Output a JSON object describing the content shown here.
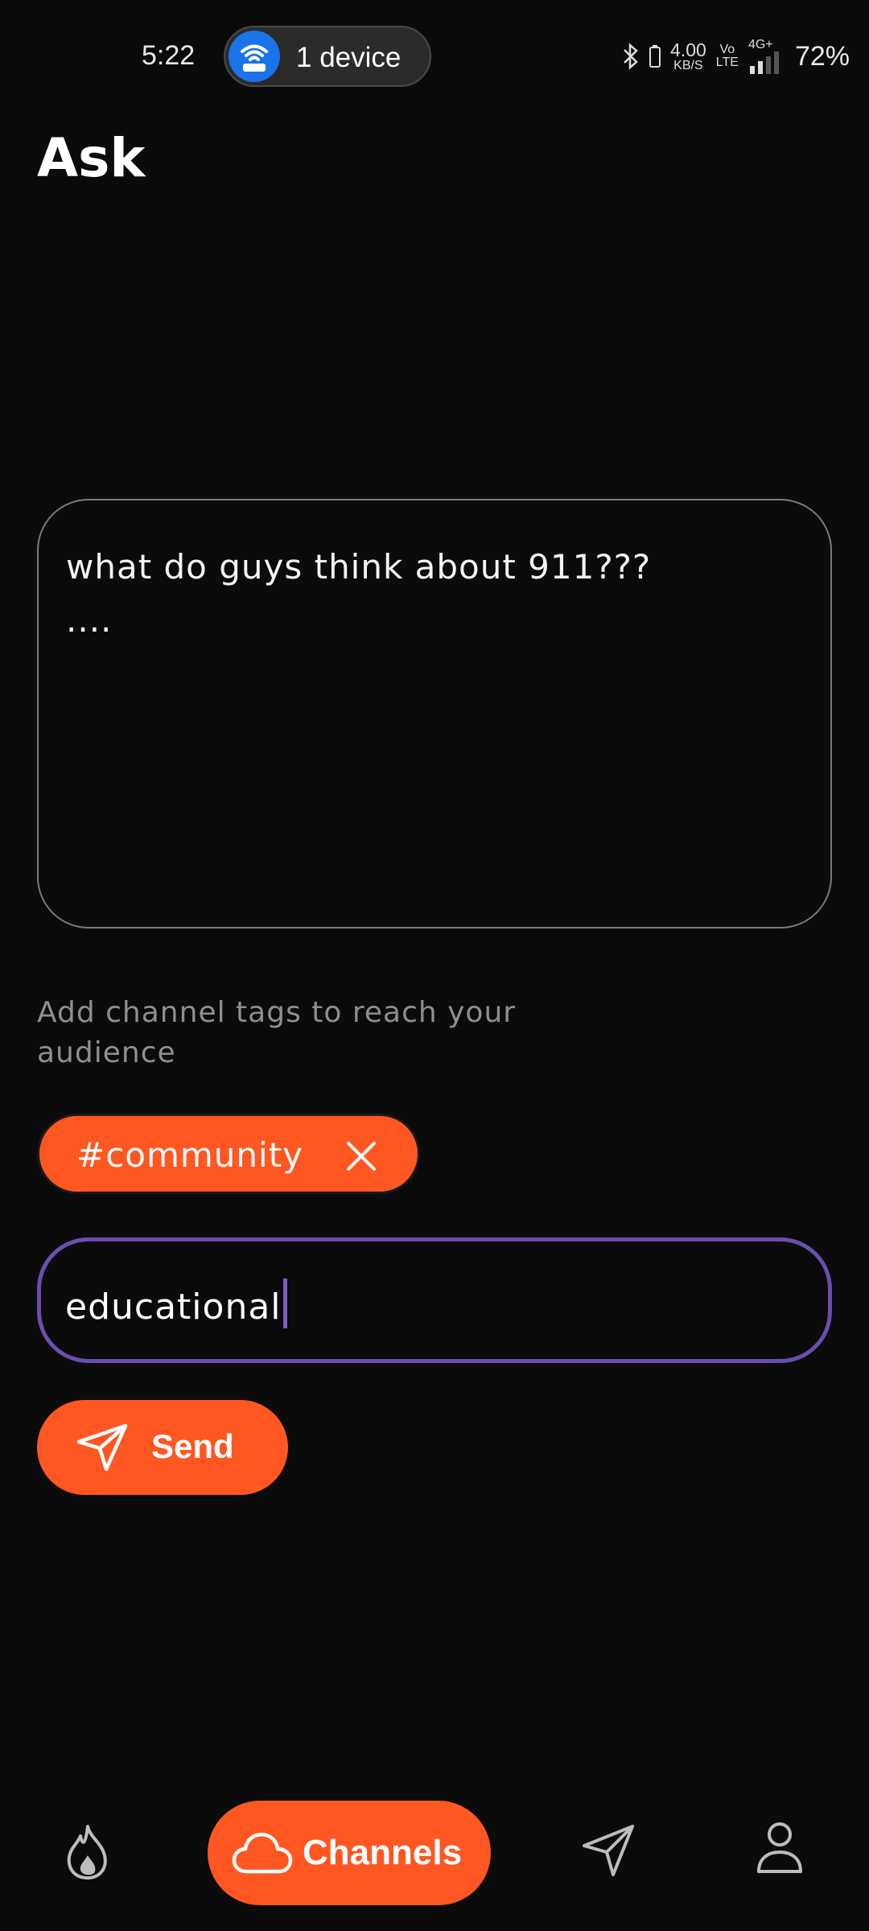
{
  "status_bar": {
    "time": "5:22",
    "hotspot_label": "1 device",
    "speed_value": "4.00",
    "speed_unit": "KB/S",
    "volte_top": "Vo",
    "volte_bottom": "LTE",
    "network": "4G+",
    "battery": "72%",
    "icons": [
      "wifi-hotspot-icon",
      "bluetooth-icon",
      "battery-icon",
      "signal-icon"
    ]
  },
  "page": {
    "title": "Ask"
  },
  "question": {
    "text": "what do guys think about 911???\n...."
  },
  "tags": {
    "hint": "Add channel tags to reach your audience",
    "chips": [
      {
        "label": "#community"
      }
    ],
    "input_value": "educational"
  },
  "actions": {
    "send_label": "Send"
  },
  "bottom_nav": {
    "channels_label": "Channels",
    "icons": [
      "flame-icon",
      "cloud-icon",
      "paper-plane-icon",
      "profile-icon"
    ]
  },
  "colors": {
    "background": "#0b0b0b",
    "accent": "#ff5722",
    "focus_border": "#6a4fb0",
    "hotspot_blue": "#1a73e8"
  }
}
